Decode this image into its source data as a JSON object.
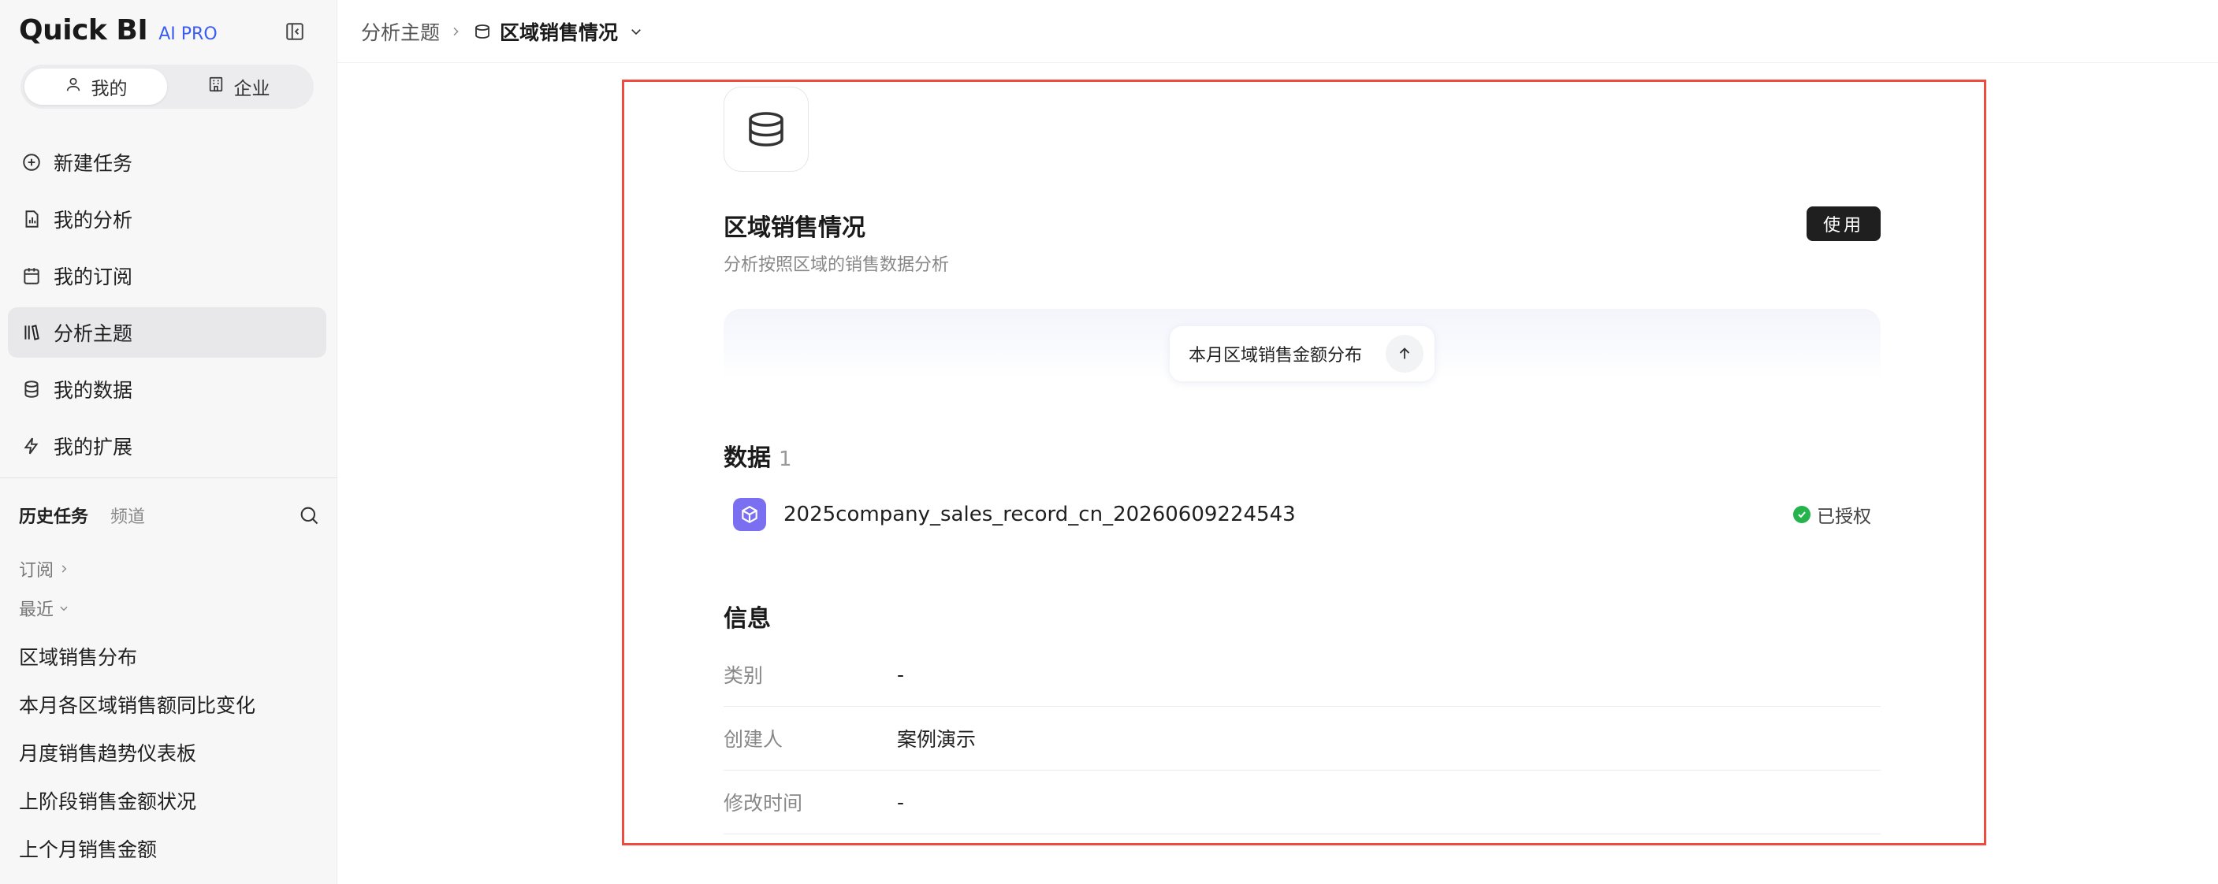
{
  "brand": {
    "name": "Quick BI",
    "tag": "AI PRO"
  },
  "scope": {
    "mine": "我的",
    "enterprise": "企业"
  },
  "nav": [
    {
      "label": "新建任务",
      "icon": "plus-circle-icon"
    },
    {
      "label": "我的分析",
      "icon": "chart-doc-icon"
    },
    {
      "label": "我的订阅",
      "icon": "calendar-icon"
    },
    {
      "label": "分析主题",
      "icon": "library-icon",
      "active": true
    },
    {
      "label": "我的数据",
      "icon": "database-icon"
    },
    {
      "label": "我的扩展",
      "icon": "lightning-icon"
    }
  ],
  "history": {
    "tab_active": "历史任务",
    "tab_other": "频道",
    "subscribe_label": "订阅",
    "recent_label": "最近",
    "items": [
      "区域销售分布",
      "本月各区域销售额同比变化",
      "月度销售趋势仪表板",
      "上阶段销售金额状况",
      "上个月销售金额"
    ]
  },
  "breadcrumb": {
    "parent": "分析主题",
    "current": "区域销售情况"
  },
  "topic": {
    "title": "区域销售情况",
    "description": "分析按照区域的销售数据分析",
    "use_label": "使用",
    "suggestion": "本月区域销售金额分布"
  },
  "data_section": {
    "title": "数据",
    "count": "1",
    "dataset_name": "2025company_sales_record_cn_20260609224543",
    "status": "已授权"
  },
  "info_section": {
    "title": "信息",
    "rows": [
      {
        "key": "类别",
        "value": "-"
      },
      {
        "key": "创建人",
        "value": "案例演示"
      },
      {
        "key": "修改时间",
        "value": "-"
      }
    ]
  },
  "colors": {
    "accent": "#3a5cf0",
    "highlight_frame": "#ef4b3f",
    "dataset_icon": "#7a6ff0",
    "status_ok": "#25b34b"
  }
}
